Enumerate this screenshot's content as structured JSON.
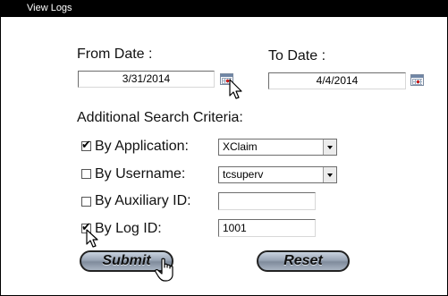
{
  "window": {
    "title": "View Logs"
  },
  "dates": {
    "from_label": "From Date :",
    "from_value": "3/31/2014",
    "to_label": "To Date :",
    "to_value": "4/4/2014"
  },
  "criteria": {
    "heading": "Additional Search Criteria:",
    "application": {
      "label": "By Application:",
      "checked": true,
      "value": "XClaim"
    },
    "username": {
      "label": "By Username:",
      "checked": false,
      "value": "tcsuperv"
    },
    "auxiliary_id": {
      "label": "By Auxiliary ID:",
      "checked": false,
      "value": ""
    },
    "log_id": {
      "label": "By Log ID:",
      "checked": true,
      "value": "1001"
    }
  },
  "actions": {
    "submit_label": "Submit",
    "reset_label": "Reset"
  },
  "icons": {
    "calendar": "calendar-icon",
    "checkmark": "checkmark-icon",
    "dropdown": "chevron-down-icon",
    "cursor_arrow": "arrow-cursor-icon",
    "cursor_hand": "hand-cursor-icon"
  },
  "colors": {
    "titlebar": "#000000",
    "button_fill": "#9aa6b6",
    "button_border": "#222222"
  }
}
